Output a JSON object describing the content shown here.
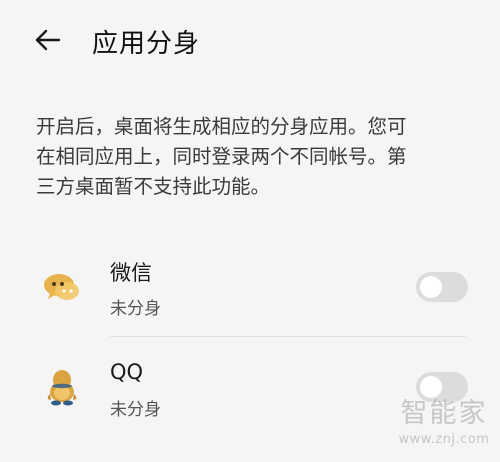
{
  "header": {
    "back_icon": "arrow-left-icon",
    "title": "应用分身"
  },
  "description": {
    "lines": [
      "开启后，桌面将生成相应的分身应用。您可",
      "在相同应用上，同时登录两个不同帐号。第",
      "三方桌面暂不支持此功能。"
    ]
  },
  "apps": [
    {
      "name": "微信",
      "status": "未分身",
      "icon": "wechat-icon",
      "enabled": false
    },
    {
      "name": "QQ",
      "status": "未分身",
      "icon": "qq-penguin-icon",
      "enabled": false
    }
  ],
  "watermark": {
    "brand": "智能家",
    "url": "www.znj.com"
  },
  "colors": {
    "background": "#f5f5f5",
    "toggle_off": "#dcdcdc",
    "wechat_icon": "#e8b24c",
    "qq_icon_body": "#d9a441",
    "qq_icon_head": "#2f5d8a"
  }
}
